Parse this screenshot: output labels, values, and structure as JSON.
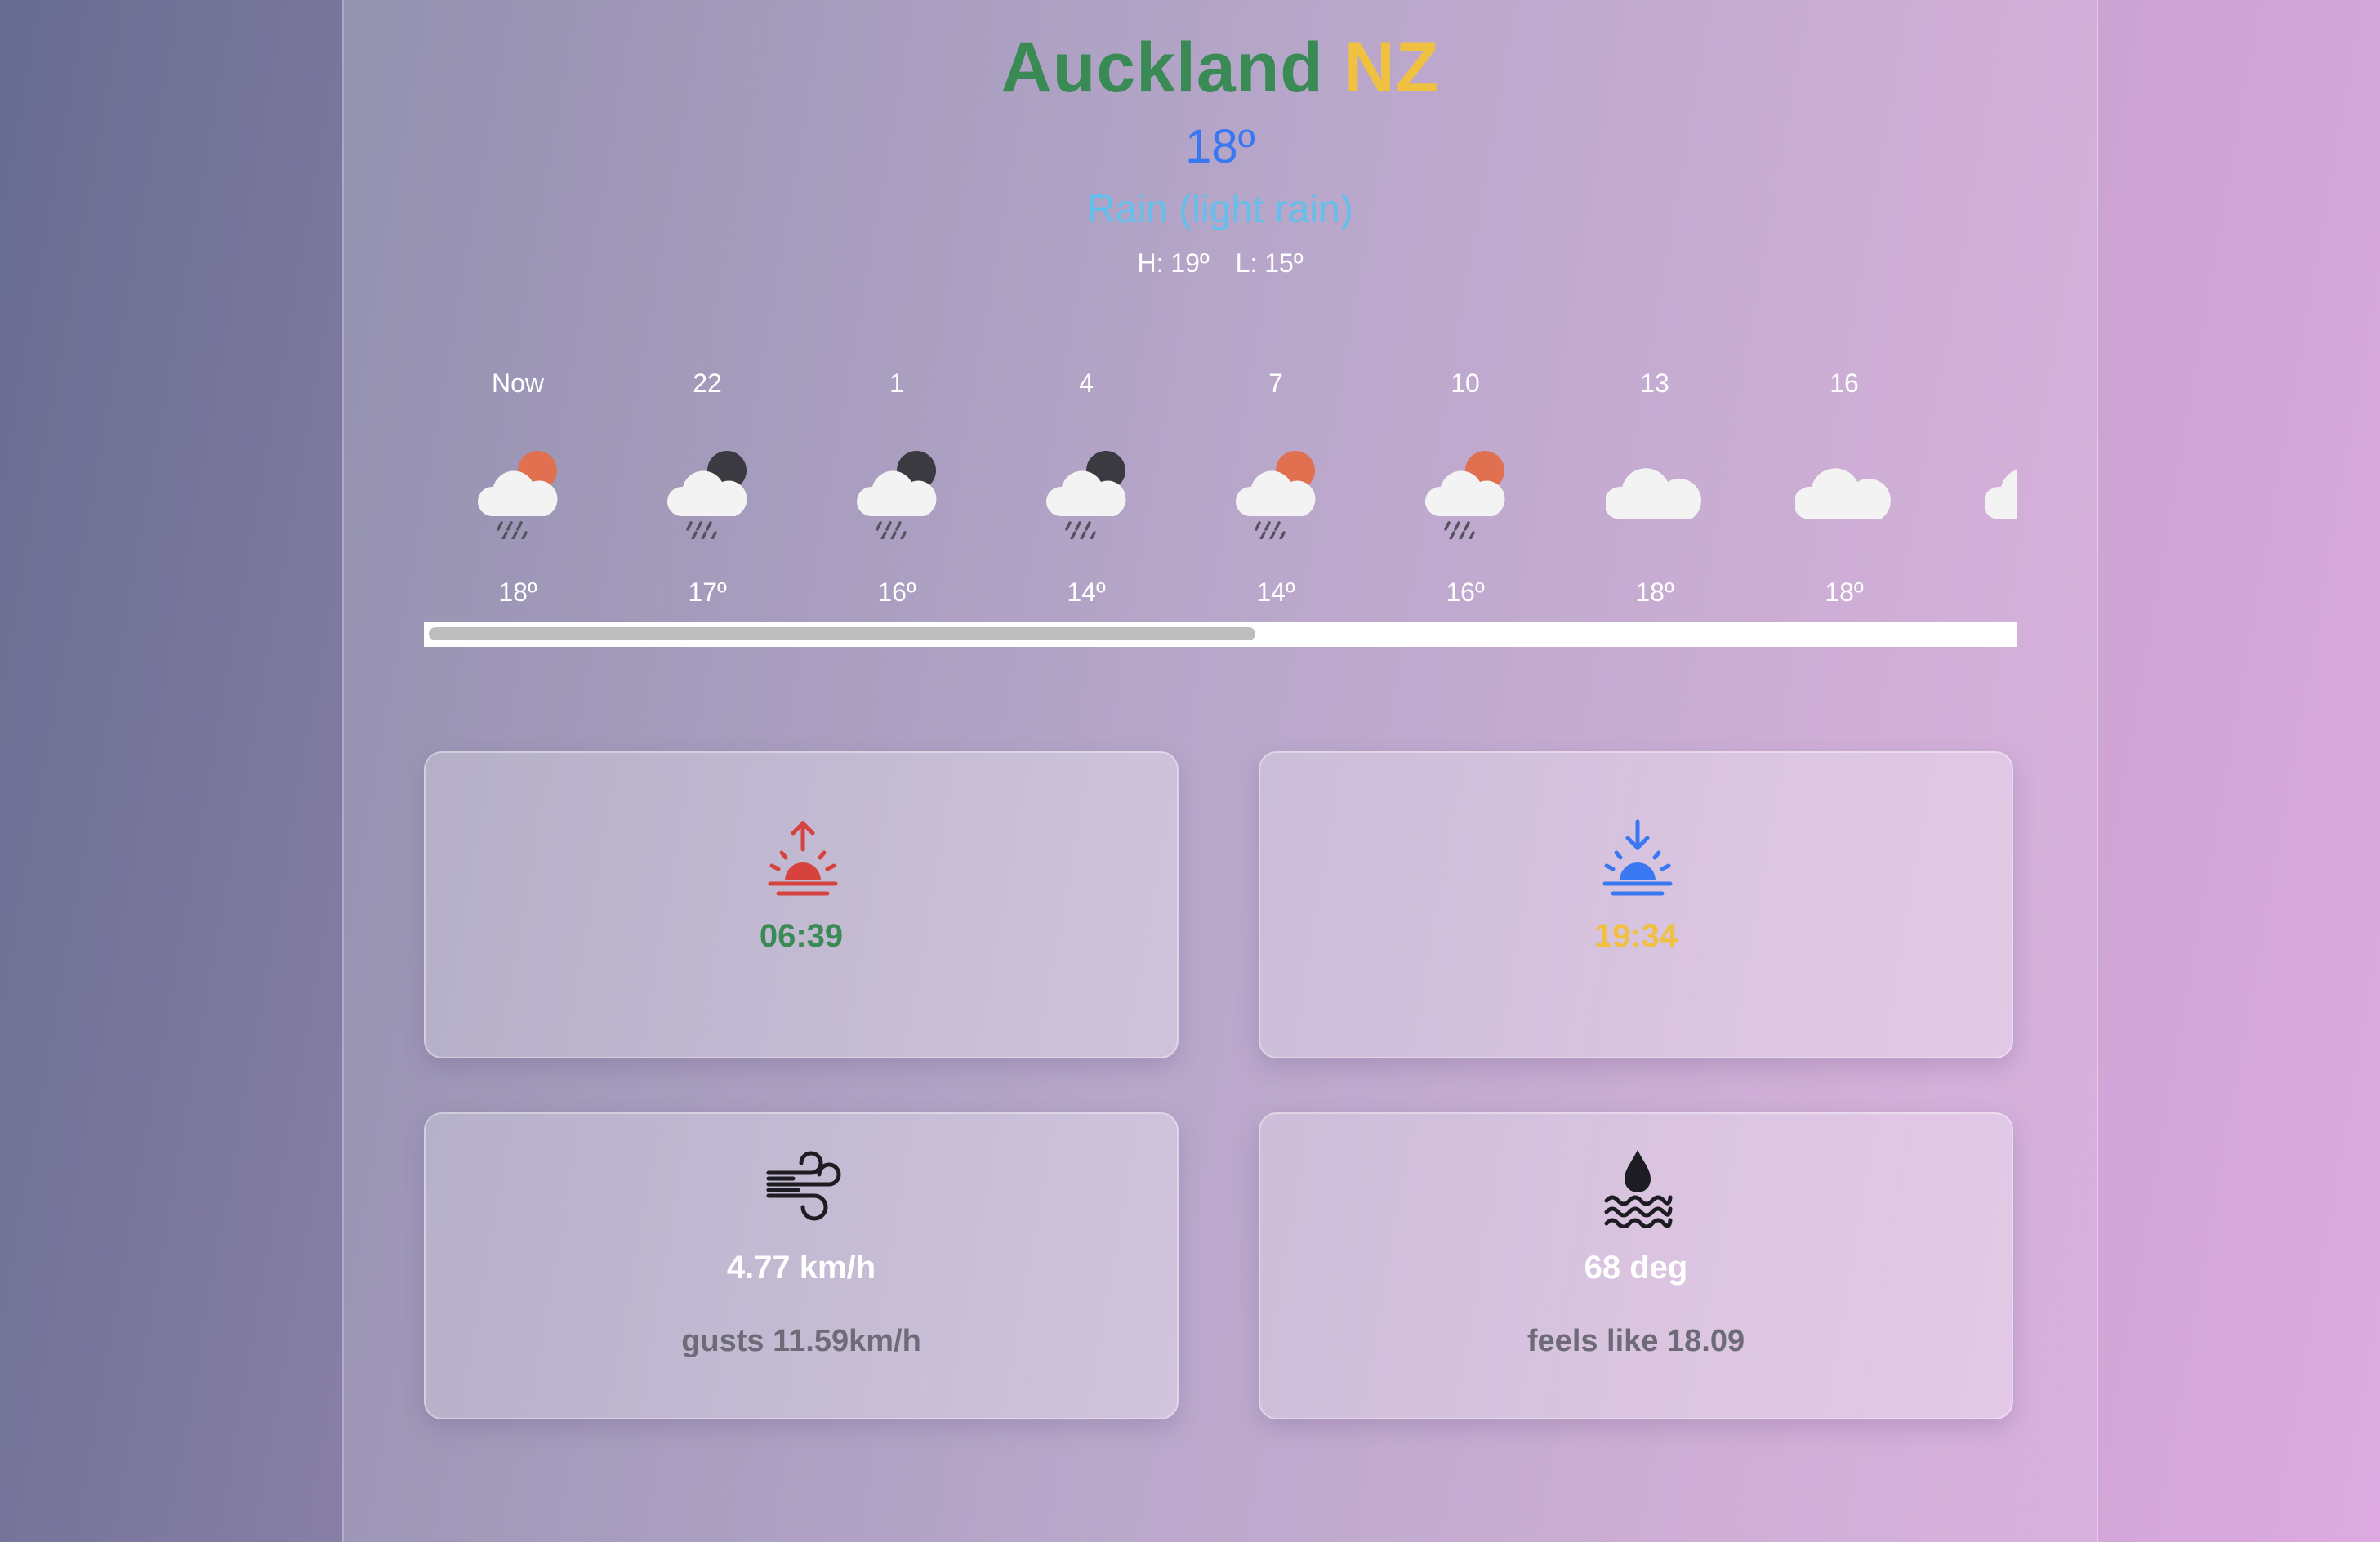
{
  "location": {
    "city": "Auckland",
    "country": "NZ"
  },
  "current": {
    "temperature": "18º",
    "description": "Rain (light rain)",
    "high": "H: 19º",
    "low": "L: 15º"
  },
  "forecast": [
    {
      "time": "Now",
      "temp": "18º",
      "icon": "rain-sun-icon"
    },
    {
      "time": "22",
      "temp": "17º",
      "icon": "rain-moon-icon"
    },
    {
      "time": "1",
      "temp": "16º",
      "icon": "rain-moon-icon"
    },
    {
      "time": "4",
      "temp": "14º",
      "icon": "rain-moon-icon"
    },
    {
      "time": "7",
      "temp": "14º",
      "icon": "rain-sun-icon"
    },
    {
      "time": "10",
      "temp": "16º",
      "icon": "rain-sun-icon"
    },
    {
      "time": "13",
      "temp": "18º",
      "icon": "cloud-icon"
    },
    {
      "time": "16",
      "temp": "18º",
      "icon": "cloud-icon"
    },
    {
      "time": "",
      "temp": "",
      "icon": "cloud-icon"
    }
  ],
  "forecast_scroll": {
    "visible_fraction": 0.52,
    "position": 0
  },
  "cards": {
    "sunrise": {
      "time": "06:39",
      "icon": "sunrise-icon"
    },
    "sunset": {
      "time": "19:34",
      "icon": "sunset-icon"
    },
    "wind": {
      "speed": "4.77 km/h",
      "gusts": "gusts 11.59km/h",
      "icon": "wind-icon"
    },
    "humidity": {
      "value": "68 deg",
      "feels_like": "feels like 18.09",
      "icon": "humidity-icon"
    }
  },
  "colors": {
    "city": "#3a8a55",
    "country": "#f0c040",
    "temperature": "#3a78f2",
    "description": "#62c0ec",
    "sunrise_icon": "#d6433e",
    "sunrise_time": "#3a8a55",
    "sunset_icon": "#3a78f2",
    "sunset_time": "#f0c040"
  }
}
